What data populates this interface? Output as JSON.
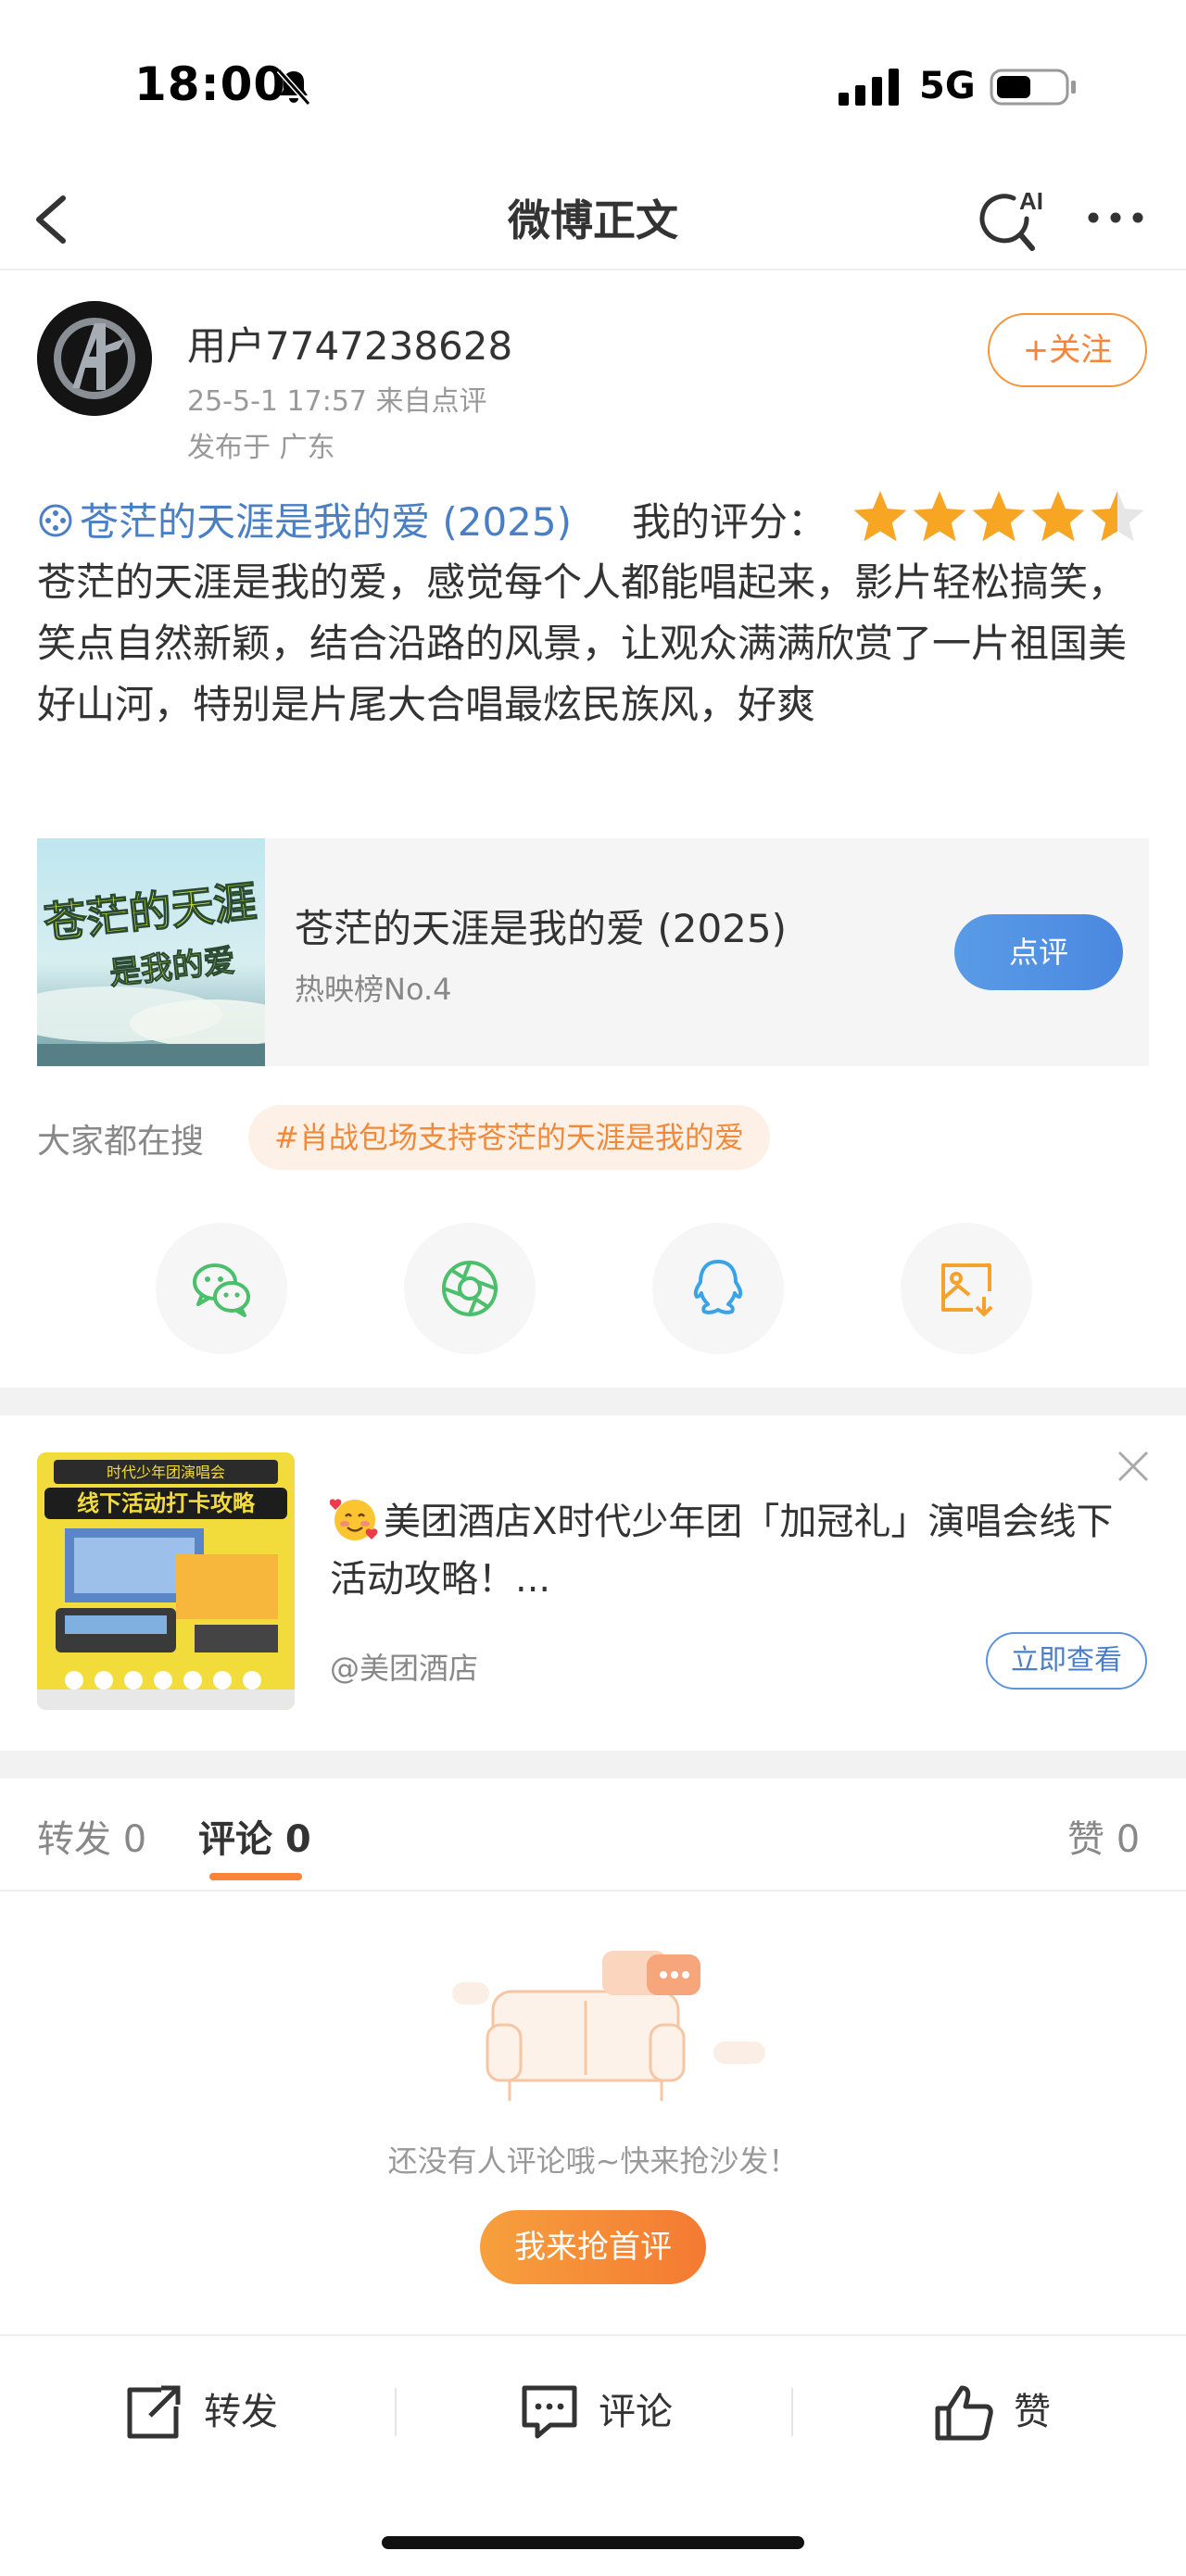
{
  "status_bar": {
    "time": "18:00",
    "network": "5G",
    "icons": [
      "mute-bell-icon",
      "signal-icon",
      "battery-icon"
    ]
  },
  "nav": {
    "title": "微博正文",
    "ai_label": "AI",
    "icons": [
      "back-icon",
      "ai-search-icon",
      "more-icon"
    ]
  },
  "post": {
    "username": "用户7747238628",
    "meta": "25-5-1 17:57   来自点评",
    "location": "发布于 广东",
    "follow_label": "+关注",
    "movie_link": "苍茫的天涯是我的爱 (2025)",
    "rating_label": "我的评分：",
    "rating": 4.5,
    "rating_max": 5,
    "body": "苍茫的天涯是我的爱，感觉每个人都能唱起来，影片轻松搞笑，笑点自然新颖，结合沿路的风景，让观众满满欣赏了一片祖国美好山河，特别是片尾大合唱最炫民族风，好爽"
  },
  "movie_card": {
    "title": "苍茫的天涯是我的爱 (2025)",
    "subtitle": "热映榜No.4",
    "button": "点评",
    "poster_title": "苍茫的天涯是我的爱"
  },
  "search": {
    "label": "大家都在搜",
    "tag": "#肖战包场支持苍茫的天涯是我的爱"
  },
  "share": {
    "icons": [
      "wechat-icon",
      "moments-icon",
      "qq-icon",
      "save-image-icon"
    ]
  },
  "ad": {
    "text": "美团酒店X时代少年团「加冠礼」演唱会线下活动攻略！...",
    "source": "@美团酒店",
    "button": "立即查看",
    "image_banner": "线下活动打卡攻略",
    "image_caption": "时代少年团演唱会"
  },
  "tabs": {
    "repost": "转发 0",
    "comment": "评论 0",
    "like": "赞 0"
  },
  "empty": {
    "text": "还没有人评论哦~快来抢沙发！",
    "button": "我来抢首评"
  },
  "bottom_bar": {
    "repost": "转发",
    "comment": "评论",
    "like": "赞"
  },
  "colors": {
    "accent_orange": "#f7843a",
    "link_blue": "#4a7fc5",
    "star": "#f6a623"
  }
}
